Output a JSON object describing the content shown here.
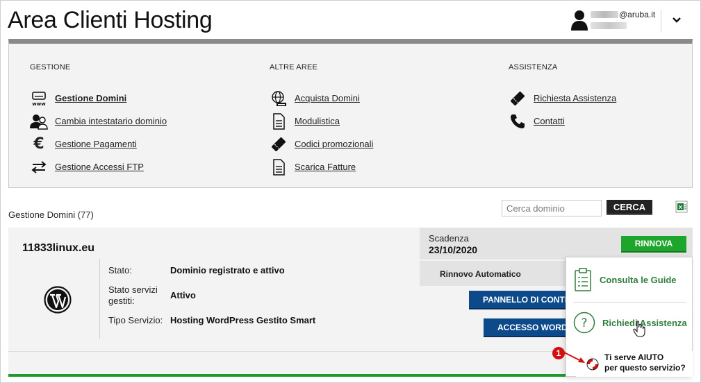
{
  "header": {
    "title": "Area Clienti Hosting",
    "user_email_suffix": "@aruba.it"
  },
  "menu": {
    "columns": [
      {
        "heading": "GESTIONE",
        "items": [
          {
            "label": "Gestione Domini",
            "icon": "server-www-icon",
            "active": true
          },
          {
            "label": "Cambia intestatario dominio",
            "icon": "users-icon"
          },
          {
            "label": "Gestione Pagamenti",
            "icon": "euro-icon"
          },
          {
            "label": "Gestione Accessi FTP",
            "icon": "transfer-arrows-icon"
          }
        ]
      },
      {
        "heading": "ALTRE AREE",
        "items": [
          {
            "label": "Acquista Domini",
            "icon": "globe-icon"
          },
          {
            "label": "Modulistica",
            "icon": "document-icon"
          },
          {
            "label": "Codici promozionali",
            "icon": "ticket-icon"
          },
          {
            "label": "Scarica Fatture",
            "icon": "document-icon"
          }
        ]
      },
      {
        "heading": "ASSISTENZA",
        "items": [
          {
            "label": "Richiesta Assistenza",
            "icon": "ticket-icon"
          },
          {
            "label": "Contatti",
            "icon": "phone-icon"
          }
        ]
      }
    ]
  },
  "domains": {
    "title": "Gestione Domini (77)",
    "search_placeholder": "Cerca dominio",
    "search_button": "CERCA",
    "card": {
      "domain": "11833linux.eu",
      "fields": [
        {
          "label": "Stato:",
          "value": "Dominio registrato e attivo"
        },
        {
          "label": "Stato servizi gestiti:",
          "value": "Attivo"
        },
        {
          "label": "Tipo Servizio:",
          "value": "Hosting WordPress Gestito Smart"
        }
      ],
      "expiry_label": "Scadenza",
      "expiry_date": "23/10/2020",
      "renew_button": "RINNOVA",
      "auto_renew_label": "Rinnovo Automatico",
      "panel_button": "PANNELLO DI CONTR",
      "wp_access_button": "ACCESSO WORDP"
    }
  },
  "help": {
    "guides": "Consulta le Guide",
    "request": "Richiedi Assistenza",
    "cta_line1": "Ti serve AIUTO",
    "cta_line2": "per questo servizio?",
    "badge": "1"
  },
  "colors": {
    "green": "#1ea52b",
    "blue": "#0d4a8c",
    "help_green": "#2f7d3a",
    "badge_red": "#d21010"
  }
}
